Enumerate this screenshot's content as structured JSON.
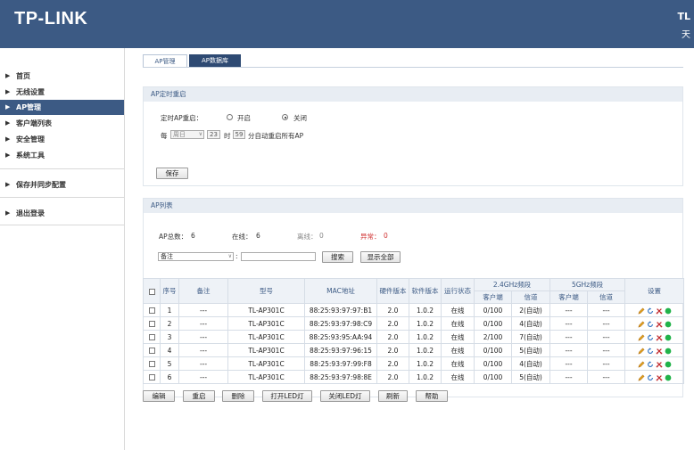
{
  "header": {
    "logo": "TP-LINK",
    "model_partial": "TL",
    "model_partial2": "天"
  },
  "sidebar": {
    "items": [
      {
        "label": "首页"
      },
      {
        "label": "无线设置"
      },
      {
        "label": "AP管理"
      },
      {
        "label": "客户端列表"
      },
      {
        "label": "安全管理"
      },
      {
        "label": "系统工具"
      },
      {
        "label": "保存并同步配置"
      },
      {
        "label": "退出登录"
      }
    ]
  },
  "tabs": [
    {
      "label": "AP管理"
    },
    {
      "label": "AP数据库"
    }
  ],
  "reboot": {
    "title": "AP定时重启",
    "label": "定时AP重启：",
    "opt_on": "开启",
    "opt_off": "关闭",
    "selected": "关闭",
    "every": "每",
    "day_value": "周日",
    "hour_value": "23",
    "hour_unit": "时",
    "minute_value": "59",
    "suffix": "分自动重启所有AP",
    "save_label": "保存"
  },
  "aplist": {
    "title": "AP列表",
    "total_label": "AP总数：",
    "total": "6",
    "online_label": "在线：",
    "online": "6",
    "offline_label": "离线：",
    "offline": "0",
    "abnormal_label": "异常：",
    "abnormal": "0",
    "filter_value": "备注",
    "search_label": "搜索",
    "show_all_label": "显示全部",
    "colors": {
      "abnormal": "#d03030",
      "offline": "#888888"
    }
  },
  "table": {
    "headers": {
      "index": "序号",
      "note": "备注",
      "model": "型号",
      "mac": "MAC地址",
      "hw": "硬件版本",
      "sw": "软件版本",
      "status": "运行状态",
      "band24": "2.4GHz频段",
      "band5": "5GHz频段",
      "clients": "客户端",
      "channel": "信道",
      "settings": "设置"
    },
    "rows": [
      {
        "index": "1",
        "note": "---",
        "model": "TL-AP301C",
        "mac": "88:25:93:97:97:B1",
        "hw": "2.0",
        "sw": "1.0.2",
        "status": "在线",
        "c24": "0/100",
        "ch24": "2(自动)",
        "c5": "---",
        "ch5": "---"
      },
      {
        "index": "2",
        "note": "---",
        "model": "TL-AP301C",
        "mac": "88:25:93:97:98:C9",
        "hw": "2.0",
        "sw": "1.0.2",
        "status": "在线",
        "c24": "0/100",
        "ch24": "4(自动)",
        "c5": "---",
        "ch5": "---"
      },
      {
        "index": "3",
        "note": "---",
        "model": "TL-AP301C",
        "mac": "88:25:93:95:AA:94",
        "hw": "2.0",
        "sw": "1.0.2",
        "status": "在线",
        "c24": "2/100",
        "ch24": "7(自动)",
        "c5": "---",
        "ch5": "---"
      },
      {
        "index": "4",
        "note": "---",
        "model": "TL-AP301C",
        "mac": "88:25:93:97:96:15",
        "hw": "2.0",
        "sw": "1.0.2",
        "status": "在线",
        "c24": "0/100",
        "ch24": "5(自动)",
        "c5": "---",
        "ch5": "---"
      },
      {
        "index": "5",
        "note": "---",
        "model": "TL-AP301C",
        "mac": "88:25:93:97:99:F8",
        "hw": "2.0",
        "sw": "1.0.2",
        "status": "在线",
        "c24": "0/100",
        "ch24": "4(自动)",
        "c5": "---",
        "ch5": "---"
      },
      {
        "index": "6",
        "note": "---",
        "model": "TL-AP301C",
        "mac": "88:25:93:97:98:8E",
        "hw": "2.0",
        "sw": "1.0.2",
        "status": "在线",
        "c24": "0/100",
        "ch24": "5(自动)",
        "c5": "---",
        "ch5": "---"
      }
    ],
    "row_icons": [
      "edit-icon",
      "refresh-icon",
      "delete-icon",
      "led-status-icon"
    ]
  },
  "actions": {
    "edit": "编辑",
    "reboot": "重启",
    "delete": "删除",
    "led_on": "打开LED灯",
    "led_off": "关闭LED灯",
    "refresh": "刷新",
    "help": "帮助"
  }
}
